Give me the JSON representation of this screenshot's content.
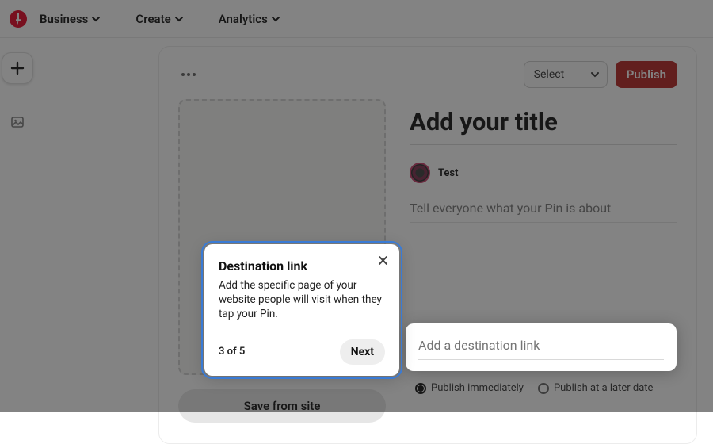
{
  "nav": {
    "items": [
      "Business",
      "Create",
      "Analytics"
    ]
  },
  "rail": {
    "plus_title": "New",
    "media_title": "Media"
  },
  "head": {
    "select_label": "Select",
    "publish_label": "Publish"
  },
  "upload": {
    "save_from_site": "Save from site"
  },
  "form": {
    "title_placeholder": "Add your title",
    "profile_name": "Test",
    "desc_placeholder": "Tell everyone what your Pin is about",
    "dest_placeholder": "Add a destination link"
  },
  "schedule": {
    "immediate": "Publish immediately",
    "later": "Publish at a later date"
  },
  "tour": {
    "title": "Destination link",
    "body": "Add the specific page of your website people will visit when they tap your Pin.",
    "step": "3 of 5",
    "next": "Next"
  }
}
